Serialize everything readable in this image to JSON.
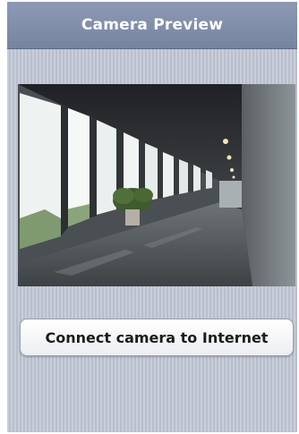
{
  "header": {
    "title": "Camera Preview"
  },
  "preview": {
    "icon": "camera-feed-image"
  },
  "actions": {
    "connect_label": "Connect camera to Internet"
  },
  "colors": {
    "title_bar": "#7f8daa",
    "background_stripe_light": "#c9ced9",
    "background_stripe_dark": "#b8bfcc",
    "button_background": "#ffffff",
    "button_text": "#1c1c1c"
  }
}
